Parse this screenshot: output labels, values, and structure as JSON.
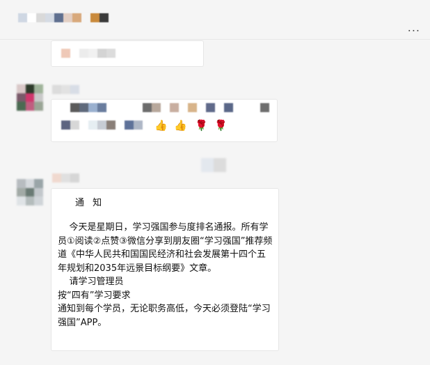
{
  "notice": {
    "title": "通 知",
    "body": "    今天是星期日，学习强国参与度排名通报。所有学员①阅读②点赞③微信分享到朋友圈“学习强国”推荐频道《中华人民共和国国民经济和社会发展第十四个五年规划和2035年远景目标纲要》文章。\n    请学习管理员\n按“四有”学习要求\n通知到每个学员，无论职务高低，今天必须登陆“学习强国”APP。"
  },
  "emojis": {
    "thumbs_up": "👍",
    "rose": "🌹"
  },
  "topbar": {
    "more_label": "..."
  }
}
